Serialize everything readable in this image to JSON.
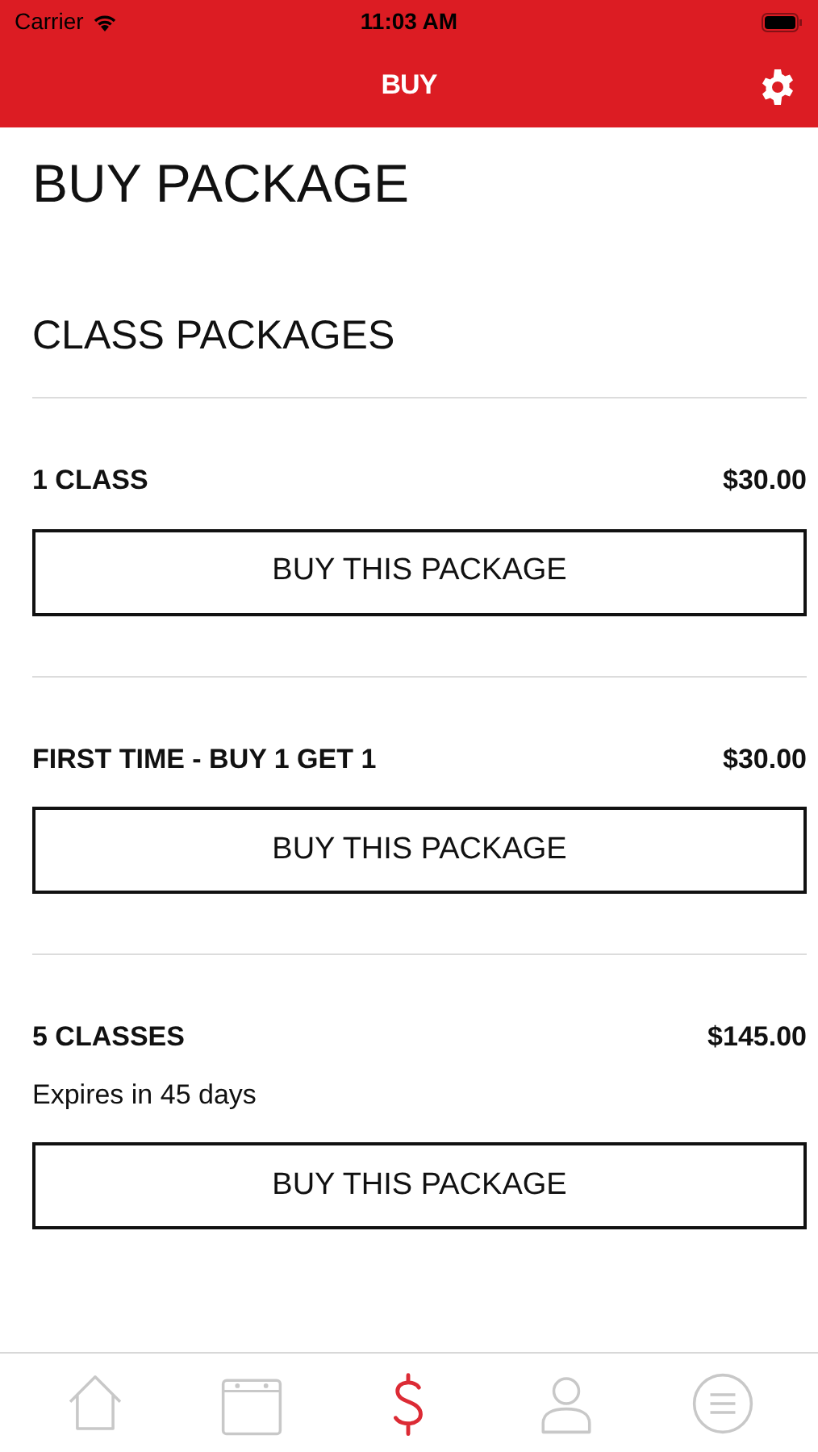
{
  "status_bar": {
    "carrier": "Carrier",
    "time": "11:03 AM"
  },
  "nav": {
    "title": "BUY"
  },
  "page_title": "BUY PACKAGE",
  "section_title": "CLASS PACKAGES",
  "packages": [
    {
      "name": "1 CLASS",
      "price": "$30.00",
      "button": "BUY THIS PACKAGE"
    },
    {
      "name": "FIRST TIME - BUY 1 GET 1",
      "price": "$30.00",
      "button": "BUY THIS PACKAGE"
    },
    {
      "name": "5 CLASSES",
      "price": "$145.00",
      "note": "Expires in 45 days",
      "button": "BUY THIS PACKAGE"
    }
  ],
  "tabs": [
    {
      "kind": "home",
      "selected": false
    },
    {
      "kind": "calendar",
      "selected": false
    },
    {
      "kind": "buy",
      "selected": true
    },
    {
      "kind": "profile",
      "selected": false
    },
    {
      "kind": "menu",
      "selected": false
    }
  ]
}
